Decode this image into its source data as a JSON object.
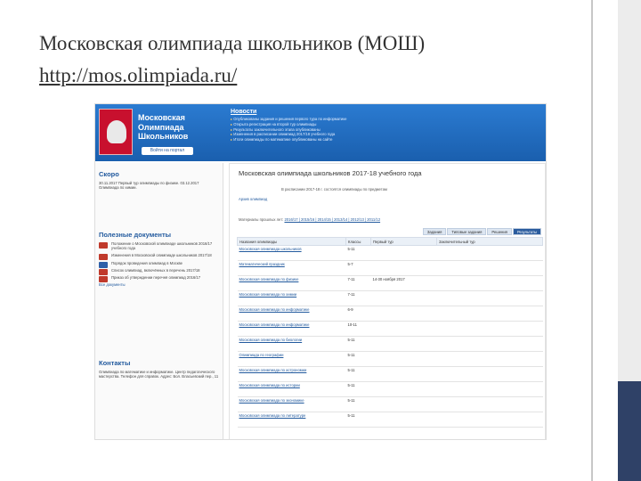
{
  "slide": {
    "title": "Московская олимпиада школьников (МОШ)",
    "link": "http://mos.olimpiada.ru/"
  },
  "colors": {
    "header_blue": "#1a5fae",
    "accent_navy": "#2f4167",
    "link_blue": "#225a9e",
    "logo_red": "#c8102e"
  },
  "site": {
    "brand_lines": [
      "Московская",
      "Олимпиада",
      "Школьников"
    ],
    "login_label": "Войти на портал",
    "news_title": "Новости",
    "news_items": [
      "Опубликованы задания и решения первого тура по информатике",
      "Открыта регистрация на второй тур олимпиады",
      "Результаты заключительного этапа опубликованы",
      "Изменения в расписании олимпиад 2017/18 учебного года",
      "Итоги олимпиады по математике опубликованы на сайте"
    ],
    "sidebar": {
      "soon_title": "Скоро",
      "soon_text": "30.11.2017 Первый тур олимпиады по физике. 03.12.2017 Олимпиада по химии.",
      "docs_title": "Полезные документы",
      "docs": [
        "Положение о Московской олимпиаде школьников 2016/17 учебного года",
        "Изменения в Московской олимпиаде школьников 2017/18",
        "Порядок проведения олимпиад в Москве",
        "Список олимпиад, включённых в перечень 2017/18",
        "Приказ об утверждении перечня олимпиад 2016/17"
      ],
      "all_docs_label": "Все документы",
      "contacts_title": "Контакты",
      "contacts_text": "Олимпиада по математике и информатике. Центр педагогического мастерства. Телефон для справок. Адрес: Бол. Власьевский пер., 11"
    },
    "main": {
      "title": "Московская олимпиада школьников 2017-18 учебного года",
      "subtitle": "В расписании 2017-18 г. состоятся олимпиады по предметам",
      "archive_label": "Архив олимпиад",
      "materials_label": "Материалы прошлых лет:",
      "materials_links": "2016/17 | 2015/16 | 2014/15 | 2013/14 | 2012/13 | 2011/12",
      "tabs": [
        "Задания",
        "Типовые задания",
        "Решения",
        "Результаты"
      ],
      "active_tab": "Результаты",
      "table": {
        "headers": [
          "Названия олимпиады",
          "Классы",
          "Первый тур",
          "Заключительный тур"
        ],
        "rows": [
          [
            "Московская олимпиада школьников",
            "5-11",
            "",
            ""
          ],
          [
            "Математический праздник",
            "5-7",
            "",
            ""
          ],
          [
            "Московская олимпиада по физике",
            "7-11",
            "14-30 ноября 2017",
            ""
          ],
          [
            "Московская олимпиада по химии",
            "7-11",
            "",
            ""
          ],
          [
            "Московская олимпиада по информатике",
            "6-9",
            "",
            ""
          ],
          [
            "Московская олимпиада по информатике",
            "10-11",
            "",
            ""
          ],
          [
            "Московская олимпиада по биологии",
            "5-11",
            "",
            ""
          ],
          [
            "Олимпиада по географии",
            "5-11",
            "",
            ""
          ],
          [
            "Московская олимпиада по астрономии",
            "5-11",
            "",
            ""
          ],
          [
            "Московская олимпиада по истории",
            "5-11",
            "",
            ""
          ],
          [
            "Московская олимпиада по экономике",
            "5-11",
            "",
            ""
          ],
          [
            "Московская олимпиада по литературе",
            "5-11",
            "",
            ""
          ]
        ]
      }
    }
  }
}
